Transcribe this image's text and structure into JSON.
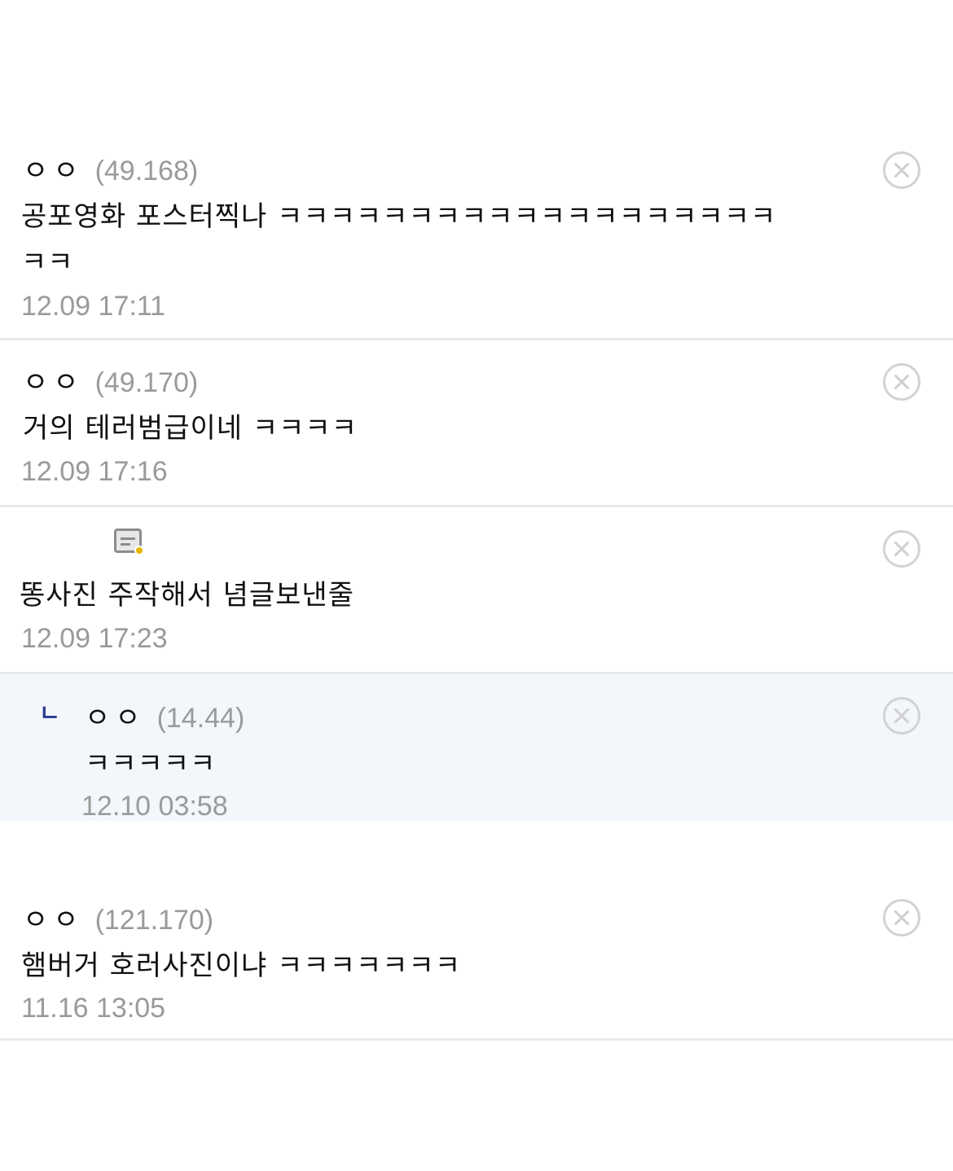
{
  "comments": [
    {
      "nick": "ㅇㅇ",
      "ip": "(49.168)",
      "text": "공포영화 포스터찍나 ㅋㅋㅋㅋㅋㅋㅋㅋㅋㅋㅋㅋㅋㅋㅋㅋㅋㅋㅋ",
      "text2": "ㅋㅋ",
      "time": "12.09 17:11"
    },
    {
      "nick": "ㅇㅇ",
      "ip": "(49.170)",
      "text": "거의 테러범급이네 ㅋㅋㅋㅋ",
      "time": "12.09 17:16"
    },
    {
      "text": "똥사진 주작해서 념글보낸줄",
      "time": "12.09 17:23",
      "icon": "image-icon"
    },
    {
      "reply_mark": "ㄴ",
      "nick": "ㅇㅇ",
      "ip": "(14.44)",
      "text": "ㅋㅋㅋㅋㅋ",
      "time": "12.10 03:58"
    },
    {
      "nick": "ㅇㅇ",
      "ip": "(121.170)",
      "text": "햄버거 호러사진이냐 ㅋㅋㅋㅋㅋㅋㅋ",
      "time": "11.16 13:05"
    }
  ],
  "icons": {
    "delete": "close-circle-icon"
  }
}
